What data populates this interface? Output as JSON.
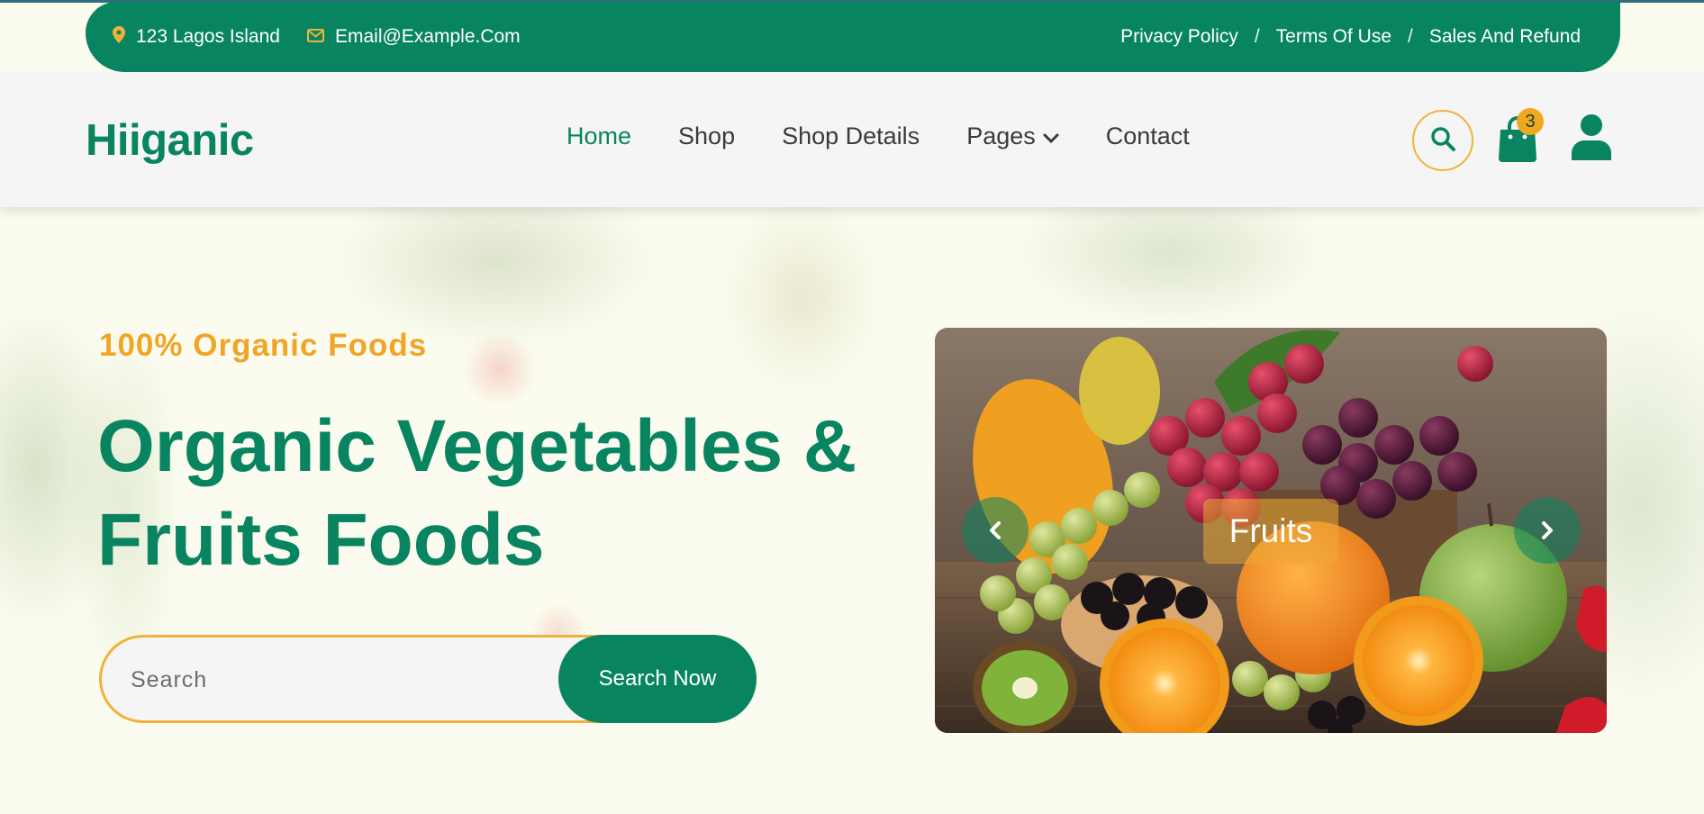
{
  "topbar": {
    "address": "123 Lagos Island",
    "email": "Email@Example.Com",
    "links": [
      "Privacy Policy",
      "Terms Of Use",
      "Sales And Refund"
    ],
    "separator": "/"
  },
  "header": {
    "logo": "Hiiganic",
    "nav": [
      {
        "label": "Home",
        "active": true
      },
      {
        "label": "Shop",
        "active": false
      },
      {
        "label": "Shop Details",
        "active": false
      },
      {
        "label": "Pages",
        "active": false,
        "dropdown": true
      },
      {
        "label": "Contact",
        "active": false
      }
    ],
    "cart_count": "3",
    "icons": [
      "search-icon",
      "shopping-bag-icon",
      "user-icon"
    ]
  },
  "hero": {
    "tagline": "100% Organic Foods",
    "headline_line1": "Organic Vegetables &",
    "headline_line2": "Fruits Foods",
    "search_placeholder": "Search",
    "search_button": "Search Now"
  },
  "carousel": {
    "slide_label": "Fruits",
    "prev_icon": "chevron-left-icon",
    "next_icon": "chevron-right-icon"
  },
  "colors": {
    "primary": "#088560",
    "accent": "#f0a527",
    "header_bg": "#f5f5f5",
    "page_bg": "#fbfcef"
  }
}
